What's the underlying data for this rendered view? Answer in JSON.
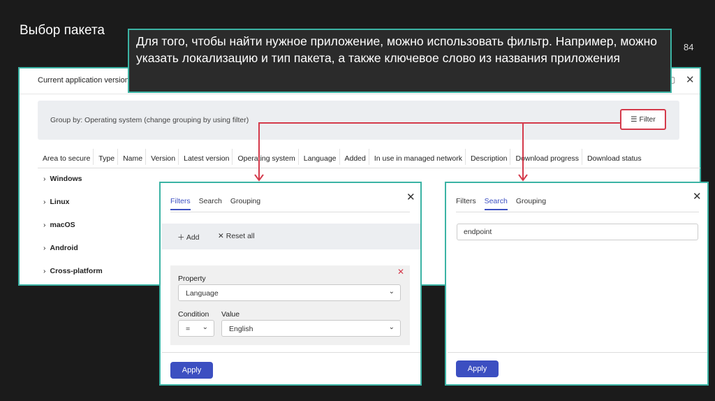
{
  "slide": {
    "title": "Выбор пакета",
    "page_number": "84",
    "callout": "Для того, чтобы найти нужное приложение, можно использовать фильтр. Например, можно указать локализацию и тип пакета, а также ключевое слово из названия приложения"
  },
  "window": {
    "title": "Current application versions",
    "groupby_text": "Group by: Operating system (change grouping by using filter)",
    "filter_label": "Filter",
    "columns": [
      "Area to secure",
      "Type",
      "Name",
      "Version",
      "Latest version",
      "Operating system",
      "Language",
      "Added",
      "In use in managed network",
      "Description",
      "Download progress",
      "Download status"
    ],
    "rows": [
      "Windows",
      "Linux",
      "macOS",
      "Android",
      "Cross-platform"
    ]
  },
  "filters_panel": {
    "tabs": [
      "Filters",
      "Search",
      "Grouping"
    ],
    "add_label": "Add",
    "reset_label": "Reset all",
    "property_label": "Property",
    "property_value": "Language",
    "condition_label": "Condition",
    "condition_value": "=",
    "value_label": "Value",
    "value_value": "English",
    "apply_label": "Apply"
  },
  "search_panel": {
    "tabs": [
      "Filters",
      "Search",
      "Grouping"
    ],
    "search_value": "endpoint",
    "apply_label": "Apply"
  },
  "colors": {
    "accent": "#3c4fc1",
    "highlight": "#d43a4b",
    "frame": "#3bb3a4"
  }
}
